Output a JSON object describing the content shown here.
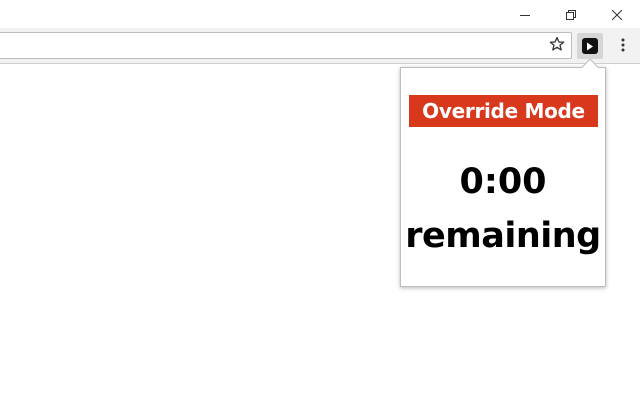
{
  "browser": {
    "address_bar": {
      "value": "",
      "placeholder": ""
    }
  },
  "popup": {
    "mode_label": "Override Mode",
    "time_remaining": "0:00",
    "remaining_label": "remaining"
  },
  "colors": {
    "banner": "#d8381c",
    "toolbar": "#f2f2f2",
    "extension_icon": "#111111"
  },
  "icons": {
    "minimize": "minimize-icon",
    "restore": "restore-icon",
    "close": "close-icon",
    "bookmark": "star-icon",
    "extension": "play-icon",
    "menu": "kebab-menu-icon"
  }
}
